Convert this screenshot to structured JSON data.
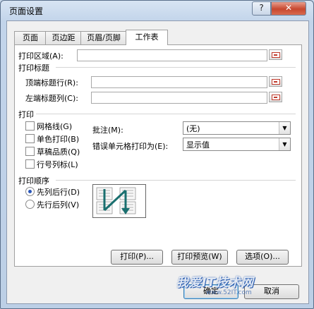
{
  "window": {
    "title": "页面设置",
    "help_label": "?",
    "close_label": "✕"
  },
  "tabs": [
    {
      "label": "页面"
    },
    {
      "label": "页边距"
    },
    {
      "label": "页眉/页脚"
    },
    {
      "label": "工作表"
    }
  ],
  "print_area": {
    "label": "打印区域(A):",
    "value": ""
  },
  "print_titles": {
    "heading": "打印标题",
    "top_rows_label": "顶端标题行(R):",
    "top_rows_value": "",
    "left_cols_label": "左端标题列(C):",
    "left_cols_value": ""
  },
  "print": {
    "heading": "打印",
    "gridlines_label": "网格线(G)",
    "black_white_label": "单色打印(B)",
    "draft_label": "草稿品质(Q)",
    "row_col_headers_label": "行号列标(L)",
    "comments_label": "批注(M):",
    "comments_value": "(无)",
    "errors_label": "错误单元格打印为(E):",
    "errors_value": "显示值"
  },
  "page_order": {
    "heading": "打印顺序",
    "down_then_over_label": "先列后行(D)",
    "over_then_down_label": "先行后列(V)",
    "selected": "down_then_over"
  },
  "buttons": {
    "print": "打印(P)...",
    "print_preview": "打印预览(W)",
    "options": "选项(O)...",
    "ok": "确定",
    "cancel": "取消"
  },
  "watermark": {
    "text": "我爱IT技术网",
    "sub": "www.52IT.com"
  },
  "colors": {
    "accent_blue": "#2a56b8",
    "close_red": "#c7472f",
    "arrow_teal": "#1a6f6f"
  }
}
